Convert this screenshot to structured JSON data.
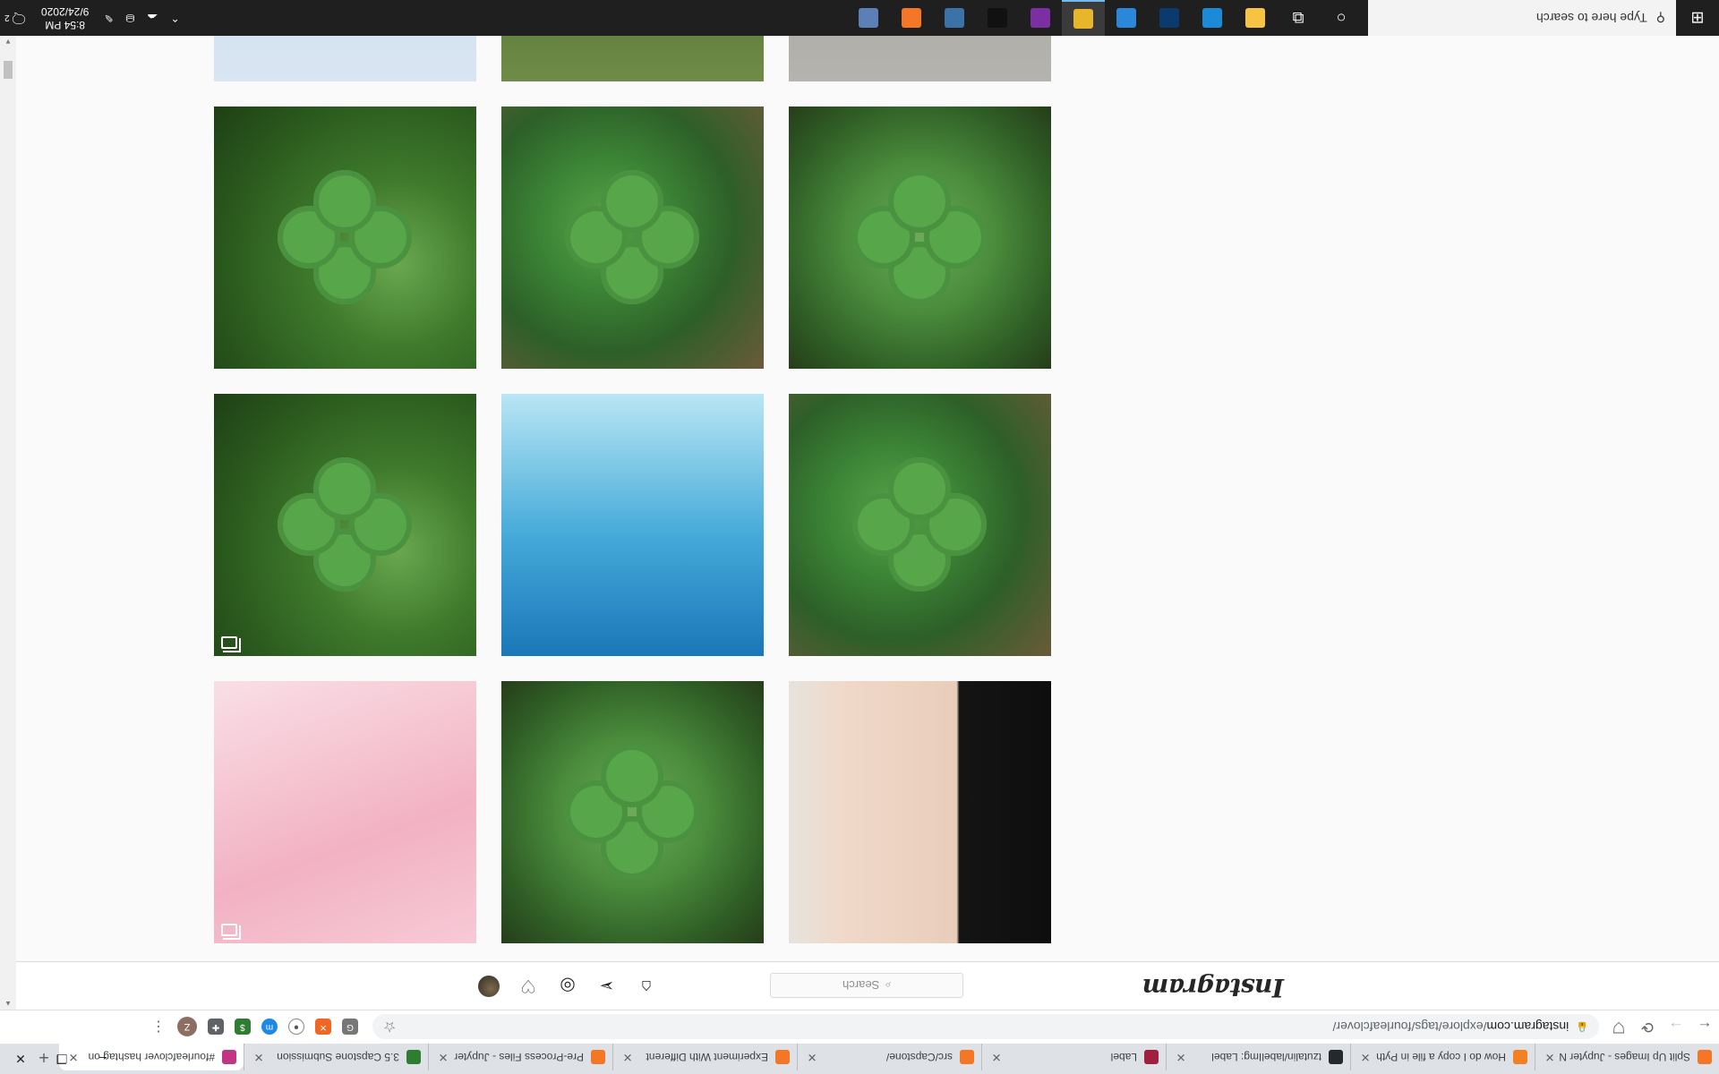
{
  "browser": {
    "tabs": [
      {
        "label": "Split Up Images - Jupyter N",
        "color": "#f37726"
      },
      {
        "label": "How do I copy a file in Pyth",
        "color": "#f48024"
      },
      {
        "label": "tzutalin/labelImg: Label",
        "color": "#24292e"
      },
      {
        "label": "Label",
        "color": "#a12040"
      },
      {
        "label": "src/Capstone/",
        "color": "#f37726"
      },
      {
        "label": "Experiment With Different",
        "color": "#f37726"
      },
      {
        "label": "Pre-Process Files - Jupyter",
        "color": "#f37726"
      },
      {
        "label": "3.5 Capstone Submission",
        "color": "#2e7d32"
      },
      {
        "label": "#fourleafclover hashtag on",
        "color": "#c13584"
      }
    ],
    "new_tab": "+",
    "window_controls": {
      "minimize": "–",
      "maximize": "❐",
      "close": "✕"
    },
    "toolbar": {
      "back": "←",
      "forward": "→",
      "reload": "⟳",
      "extension_shield": "⛉"
    },
    "url_host": "instagram.com",
    "url_path": "/explore/tags/fourleafclover/",
    "bookmark_star": "☆",
    "profile_initial": "Z",
    "menu": "⋮"
  },
  "instagram": {
    "logo": "Instagram",
    "search_placeholder": "Search",
    "search_icon": "⌕",
    "nav": {
      "home": "⌂",
      "direct": "➢",
      "explore": "◎",
      "activity": "♡"
    }
  },
  "grid_posts": [
    {
      "name": "post-tattoo-clover-wrist",
      "style": "tattoo",
      "carousel": false
    },
    {
      "name": "post-clover-cluster",
      "style": "clover3",
      "carousel": false
    },
    {
      "name": "post-pink-packets",
      "style": "pink",
      "carousel": true
    },
    {
      "name": "post-clover-large-leaf",
      "style": "clover2",
      "carousel": false
    },
    {
      "name": "post-ufo-boy",
      "style": "ufo",
      "carousel": false
    },
    {
      "name": "post-clover-leaves",
      "style": "clover",
      "carousel": true
    },
    {
      "name": "post-clover-grass",
      "style": "clover3",
      "carousel": false
    },
    {
      "name": "post-clover-field",
      "style": "clover2",
      "carousel": false
    },
    {
      "name": "post-clover-hand",
      "style": "clover",
      "carousel": false
    },
    {
      "name": "post-road-legs",
      "style": "road",
      "carousel": false
    },
    {
      "name": "post-grass",
      "style": "grass",
      "carousel": false
    },
    {
      "name": "post-flower-paper",
      "style": "paper",
      "carousel": false
    }
  ],
  "taskbar": {
    "start": "⊞",
    "search_placeholder": "Type here to search",
    "search_icon": "⚲",
    "cortana": "○",
    "task_view": "⧉",
    "apps": [
      {
        "name": "app-file-explorer",
        "color": "#f6c342"
      },
      {
        "name": "app-edge",
        "color": "#1b8bd8"
      },
      {
        "name": "app-photoshop",
        "color": "#0b3b6e"
      },
      {
        "name": "app-windows-store",
        "color": "#2b88d8"
      },
      {
        "name": "app-chrome",
        "color": "#e8b62b",
        "active": true
      },
      {
        "name": "app-onenote",
        "color": "#7b2fa3"
      },
      {
        "name": "app-terminal",
        "color": "#111111"
      },
      {
        "name": "app-python",
        "color": "#3a73a8"
      },
      {
        "name": "app-jupyter",
        "color": "#f37726"
      },
      {
        "name": "app-building",
        "color": "#5c7fb8"
      }
    ],
    "tray_icons": [
      "⌃",
      "☁",
      "⛁",
      "✎"
    ],
    "time": "8:54 PM",
    "date": "9/24/2020",
    "notification_count": "2",
    "notification_icon": "🗨"
  }
}
